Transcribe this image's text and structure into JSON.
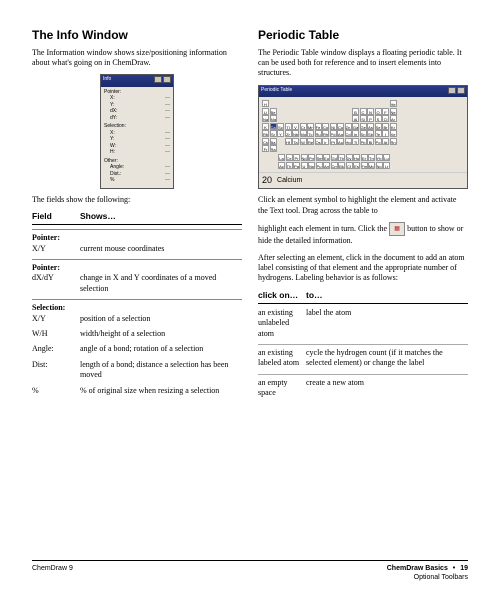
{
  "left": {
    "heading": "The Info Window",
    "intro": "The Information window shows size/positioning information about what's going on in ChemDraw.",
    "info_window": {
      "title": "Info",
      "groups": [
        {
          "label": "Pointer:",
          "rows": [
            [
              "X:",
              "—"
            ],
            [
              "Y:",
              "—"
            ],
            [
              "dX:",
              "—"
            ],
            [
              "dY:",
              "—"
            ]
          ]
        },
        {
          "label": "Selection:",
          "rows": [
            [
              "X:",
              "—"
            ],
            [
              "Y:",
              "—"
            ],
            [
              "W:",
              "—"
            ],
            [
              "H:",
              "—"
            ]
          ]
        },
        {
          "label": "Other:",
          "rows": [
            [
              "Angle:",
              "—"
            ],
            [
              "Dist.:",
              "—"
            ],
            [
              "%",
              "—"
            ]
          ]
        }
      ]
    },
    "after_image": "The fields show the following:",
    "table_head": {
      "c1": "Field",
      "c2": "Shows…"
    },
    "sections": [
      {
        "head": "Pointer:",
        "rows": [
          {
            "c1": "X/Y",
            "c2": "current mouse coordinates"
          }
        ]
      },
      {
        "head": "Pointer:",
        "rows": [
          {
            "c1": "dX/dY",
            "c2": "change in X and Y coordinates of a moved selection"
          }
        ]
      },
      {
        "head": "Selection:",
        "rows": [
          {
            "c1": "X/Y",
            "c2": "position of a selection"
          },
          {
            "c1": "W/H",
            "c2": "width/height of a selection"
          }
        ]
      },
      {
        "rows": [
          {
            "c1": "Angle:",
            "c2": "angle of a bond; rotation of a selection"
          }
        ]
      },
      {
        "rows": [
          {
            "c1": "Dist:",
            "c2": "length of a bond; distance a selection has been moved"
          }
        ]
      },
      {
        "rows": [
          {
            "c1": "%",
            "c2": "% of original size when resizing a selection"
          }
        ]
      }
    ]
  },
  "right": {
    "heading": "Periodic Table",
    "intro": "The Periodic Table window displays a floating periodic table. It can be used both for reference and to insert elements into structures.",
    "pt_window": {
      "title": "Periodic Table",
      "display_left": [
        "H",
        "Li Be",
        "Na Mg"
      ],
      "display_num": "20",
      "display_name": "Calcium",
      "elements_row1": [
        "H",
        "",
        "",
        "",
        "",
        "",
        "",
        "",
        "",
        "",
        "",
        "",
        "",
        "",
        "",
        "",
        "",
        "He"
      ],
      "elements_row2": [
        "Li",
        "Be",
        "",
        "",
        "",
        "",
        "",
        "",
        "",
        "",
        "",
        "",
        "B",
        "C",
        "N",
        "O",
        "F",
        "Ne"
      ],
      "elements_row3": [
        "Na",
        "Mg",
        "",
        "",
        "",
        "",
        "",
        "",
        "",
        "",
        "",
        "",
        "Al",
        "Si",
        "P",
        "S",
        "Cl",
        "Ar"
      ],
      "elements_row4": [
        "K",
        "Ca",
        "Sc",
        "Ti",
        "V",
        "Cr",
        "Mn",
        "Fe",
        "Co",
        "Ni",
        "Cu",
        "Zn",
        "Ga",
        "Ge",
        "As",
        "Se",
        "Br",
        "Kr"
      ],
      "elements_row5": [
        "Rb",
        "Sr",
        "Y",
        "Zr",
        "Nb",
        "Mo",
        "Tc",
        "Ru",
        "Rh",
        "Pd",
        "Ag",
        "Cd",
        "In",
        "Sn",
        "Sb",
        "Te",
        "I",
        "Xe"
      ],
      "elements_row6": [
        "Cs",
        "Ba",
        "",
        "Hf",
        "Ta",
        "W",
        "Re",
        "Os",
        "Ir",
        "Pt",
        "Au",
        "Hg",
        "Tl",
        "Pb",
        "Bi",
        "Po",
        "At",
        "Rn"
      ],
      "elements_row7": [
        "Fr",
        "Ra",
        "",
        "",
        "",
        "",
        "",
        "",
        "",
        "",
        "",
        "",
        "",
        "",
        "",
        "",
        "",
        ""
      ],
      "lanth": [
        "La",
        "Ce",
        "Pr",
        "Nd",
        "Pm",
        "Sm",
        "Eu",
        "Gd",
        "Tb",
        "Dy",
        "Ho",
        "Er",
        "Tm",
        "Yb",
        "Lu"
      ],
      "act": [
        "Ac",
        "Th",
        "Pa",
        "U",
        "Np",
        "Pu",
        "Am",
        "Cm",
        "Bk",
        "Cf",
        "Es",
        "Fm",
        "Md",
        "No",
        "Lr"
      ]
    },
    "p1a": "Click an element symbol to highlight the element and activate the Text tool. Drag across the table to",
    "p1b_pre": "highlight each element in turn. Click the ",
    "p1b_post": " button to show or hide the detailed information.",
    "p2": "After selecting an element, click in the document to add an atom label consisting of that element and the appropriate number of hydrogens. Labeling behavior is as follows:",
    "table_head": {
      "c1": "click on…",
      "c2": "to…"
    },
    "rows": [
      {
        "c1": "an existing unlabeled atom",
        "c2": "label the atom"
      },
      {
        "c1": "an existing labeled atom",
        "c2": "cycle the hydrogen count (if it matches the selected element) or change the label"
      },
      {
        "c1": "an empty space",
        "c2": "create a new atom"
      }
    ]
  },
  "footer": {
    "left": "ChemDraw 9",
    "right1": "ChemDraw Basics",
    "page": "19",
    "right2": "Optional Toolbars"
  }
}
